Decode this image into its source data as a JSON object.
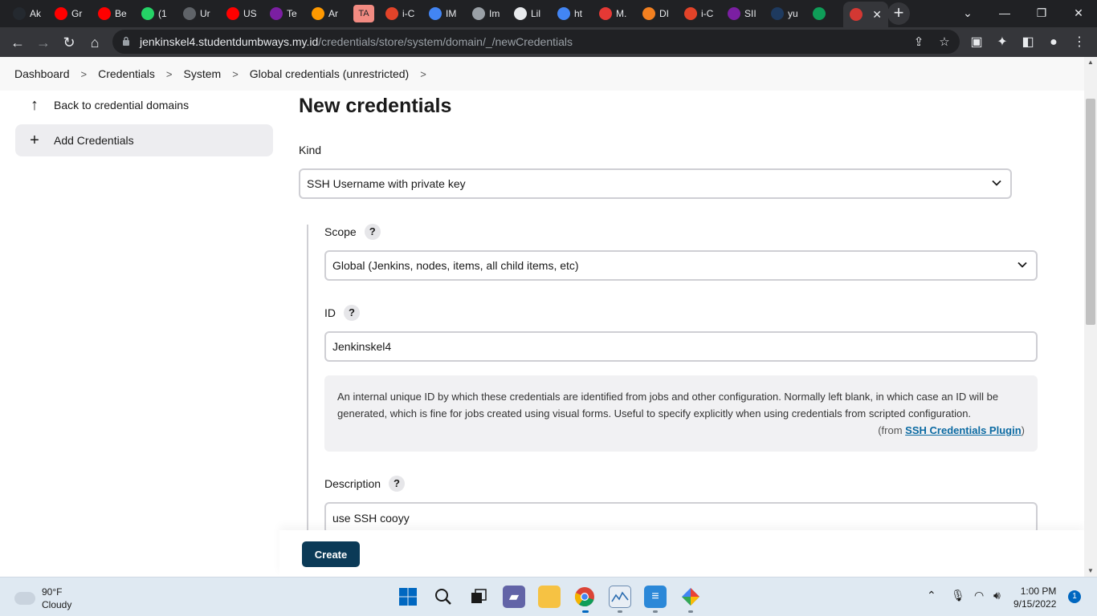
{
  "browser": {
    "tabs": [
      {
        "label": "Ak",
        "icon": "github-icon",
        "color": "#24292f"
      },
      {
        "label": "Gr",
        "icon": "youtube-icon",
        "color": "#ff0000"
      },
      {
        "label": "Be",
        "icon": "youtube-icon",
        "color": "#ff0000"
      },
      {
        "label": "(1",
        "icon": "whatsapp-icon",
        "color": "#25d366"
      },
      {
        "label": "Ur",
        "icon": "globe-icon",
        "color": "#5f6368"
      },
      {
        "label": "US",
        "icon": "youtube-icon",
        "color": "#ff0000"
      },
      {
        "label": "Te",
        "icon": "infinity-icon",
        "color": "#7b1fa2"
      },
      {
        "label": "Ar",
        "icon": "aws-icon",
        "color": "#ff9900"
      },
      {
        "label": "TA",
        "icon": "ta-badge",
        "color": "#f28b82"
      },
      {
        "label": "i-C",
        "icon": "gitlab-icon",
        "color": "#e24329"
      },
      {
        "label": "IM",
        "icon": "diamond-icon",
        "color": "#4285f4"
      },
      {
        "label": "Im",
        "icon": "gear-icon",
        "color": "#9aa0a6"
      },
      {
        "label": "Lil",
        "icon": "doc-icon",
        "color": "#e8eaed"
      },
      {
        "label": "ht",
        "icon": "google-icon",
        "color": "#4285f4"
      },
      {
        "label": "M.",
        "icon": "infinity-icon",
        "color": "#e53935"
      },
      {
        "label": "DI",
        "icon": "cloud-icon",
        "color": "#f38020"
      },
      {
        "label": "i-C",
        "icon": "gitlab-icon",
        "color": "#e24329"
      },
      {
        "label": "SII",
        "icon": "infinity-icon",
        "color": "#7b1fa2"
      },
      {
        "label": "yu",
        "icon": "circle-icon",
        "color": "#1e3a5f"
      },
      {
        "label": "",
        "icon": "drive-icon",
        "color": "#0f9d58"
      },
      {
        "label": "",
        "icon": "jenkins-icon",
        "color": "#d33833",
        "active": true
      }
    ],
    "url_host": "jenkinskel4.studentdumbways.my.id",
    "url_path": "/credentials/store/system/domain/_/newCredentials"
  },
  "breadcrumbs": [
    "Dashboard",
    "Credentials",
    "System",
    "Global credentials (unrestricted)"
  ],
  "sidebar": {
    "items": [
      {
        "label": "Back to credential domains",
        "icon": "arrow-up-icon"
      },
      {
        "label": "Add Credentials",
        "icon": "plus-icon"
      }
    ]
  },
  "page": {
    "title": "New credentials",
    "kind_label": "Kind",
    "kind_value": "SSH Username with private key",
    "scope_label": "Scope",
    "scope_value": "Global (Jenkins, nodes, items, all child items, etc)",
    "id_label": "ID",
    "id_value": "Jenkinskel4",
    "id_help_text": "An internal unique ID by which these credentials are identified from jobs and other configuration. Normally left blank, in which case an ID will be generated, which is fine for jobs created using visual forms. Useful to specify explicitly when using credentials from scripted configuration.",
    "id_help_from_prefix": "(from ",
    "id_help_from_link": "SSH Credentials Plugin",
    "id_help_from_suffix": ")",
    "description_label": "Description",
    "description_value": "use SSH cooyy",
    "help_glyph": "?",
    "create_button": "Create"
  },
  "taskbar": {
    "weather_temp": "90°F",
    "weather_desc": "Cloudy",
    "time": "1:00 PM",
    "date": "9/15/2022",
    "notifications": "1"
  }
}
